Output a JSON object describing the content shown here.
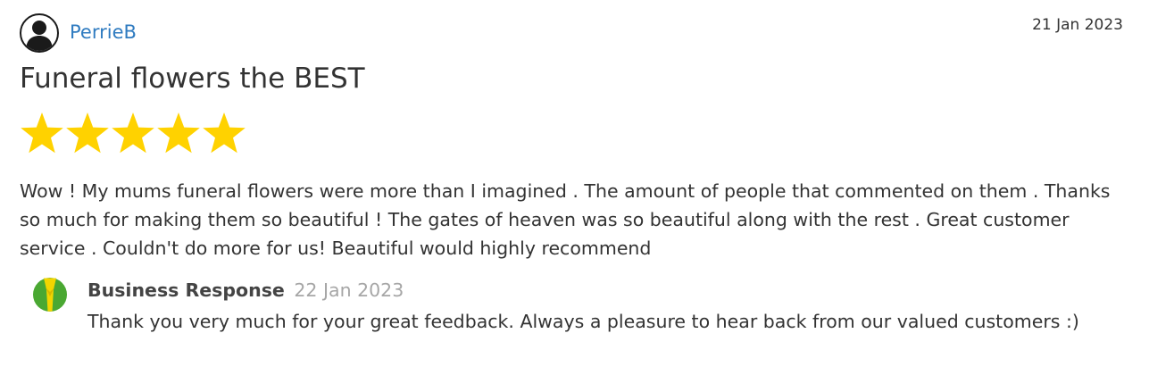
{
  "review": {
    "reviewer_name": "PerrieB",
    "date": "21 Jan 2023",
    "title": "Funeral flowers the BEST",
    "rating": 5,
    "max_rating": 5,
    "star_color": "#ffd200",
    "body": "Wow ! My mums funeral flowers were more than I imagined . The amount of people that commented on them . Thanks so much for making them so beautiful ! The gates of heaven was so beautiful along with the rest . Great customer service . Couldn't do more for us! Beautiful would highly recommend",
    "name_color": "#2f7bc0"
  },
  "response": {
    "label": "Business Response",
    "date": "22 Jan 2023",
    "body": "Thank you very much for your great feedback. Always a pleasure to hear back from our valued customers :)",
    "logo_colors": {
      "green": "#4aa832",
      "yellow": "#f2d500"
    }
  }
}
